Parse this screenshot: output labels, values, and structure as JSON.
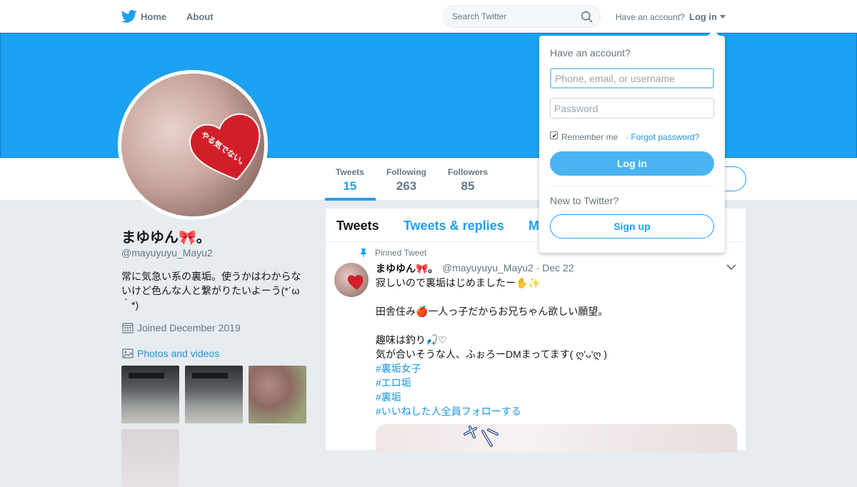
{
  "topbar": {
    "home_label": "Home",
    "about_label": "About",
    "search_placeholder": "Search Twitter",
    "have_account": "Have an account?",
    "login_label": "Log in"
  },
  "profile": {
    "name": "まゆゆん🎀。",
    "handle": "@mayuyuyu_Mayu2",
    "bio": "常に気急い系の裏垢。使うかはわからないけど色んな人と繋がりたいよーう(*´ω｀*)",
    "joined": "Joined December 2019",
    "photos_label": "Photos and videos",
    "avatar_heart_text": "やる気でない。"
  },
  "stats": [
    {
      "label": "Tweets",
      "value": "15"
    },
    {
      "label": "Following",
      "value": "263"
    },
    {
      "label": "Followers",
      "value": "85"
    }
  ],
  "timeline": {
    "tabs": [
      "Tweets",
      "Tweets & replies",
      "M"
    ],
    "pinned_label": "Pinned Tweet",
    "tweet": {
      "name": "まゆゆん🎀。",
      "meta": "@mayuyuyu_Mayu2 · Dec 22",
      "lines": [
        "寂しいので裏垢はじめましたー✋✨",
        "田舎住み🍎一人っ子だからお兄ちゃん欲しい願望。",
        "趣味は釣り🎣♡",
        "気が合いそうな人、ふぉろーDMまってます( ღ'ᴗ'ღ )"
      ],
      "hashtags": [
        "#裏垢女子",
        "#エロ垢",
        "#裏垢",
        "#いいねした人全員フォローする"
      ]
    }
  },
  "login_dropdown": {
    "title": "Have an account?",
    "username_placeholder": "Phone, email, or username",
    "password_placeholder": "Password",
    "remember_label": "Remember me",
    "forgot_label": "· Forgot password?",
    "login_button": "Log in",
    "new_label": "New to Twitter?",
    "signup_button": "Sign up"
  },
  "colors": {
    "brand_blue": "#1da1f2",
    "link_blue": "#1b95e0",
    "page_bg": "#e6ecf0"
  }
}
